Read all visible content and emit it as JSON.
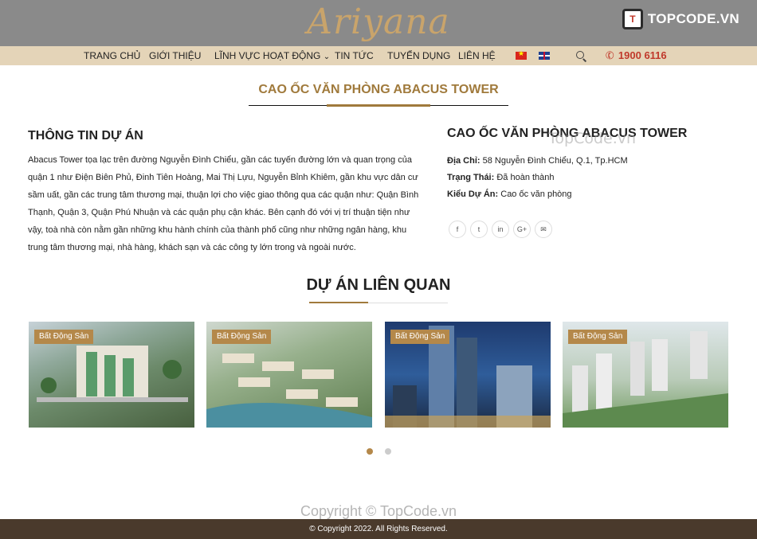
{
  "header": {
    "logo_text": "Ariyana",
    "brand": "TOPCODE.VN",
    "brand_icon": "topcode-logo-icon"
  },
  "nav": {
    "items": [
      "TRANG CHỦ",
      "GIỚI THIỆU",
      "LĨNH VỰC HOẠT ĐỘNG",
      "TIN TỨC",
      "TUYỂN DỤNG",
      "LIÊN HỆ"
    ],
    "dropdown_glyph": "⌄",
    "phone_icon": "phone-icon",
    "phone": "1900 6116",
    "phone_color": "#c0392b"
  },
  "page_title": "CAO ỐC VĂN PHÒNG ABACUS TOWER",
  "info": {
    "heading": "THÔNG TIN DỰ ÁN",
    "description": "Abacus Tower tọa lạc trên đường Nguyễn Đình Chiểu, gần các tuyến đường lớn và quan trọng của quận 1 như Điện Biên Phủ, Đinh Tiên Hoàng, Mai Thị Lựu, Nguyễn Bỉnh Khiêm, gần khu vực dân cư sầm uất, gần các trung tâm thương mại, thuận lợi cho việc giao thông qua các quận như: Quận Bình Thạnh, Quận 3, Quận Phú Nhuận và các quận phụ cận khác. Bên cạnh đó với vị trí thuận tiện như vậy, toà nhà còn nằm gần những khu hành chính của thành phố cũng như những ngân hàng, khu trung tâm thương mại, nhà hàng, khách sạn và các công ty lớn trong và ngoài nước."
  },
  "side": {
    "title": "CAO ỐC VĂN PHÒNG ABACUS TOWER",
    "watermark": "TopCode.vn",
    "address_label": "Địa Chỉ:",
    "address": "58 Nguyễn Đình Chiểu, Q.1, Tp.HCM",
    "status_label": "Trạng Thái:",
    "status": "Đã hoàn thành",
    "type_label": "Kiểu Dự Án:",
    "type": "Cao ốc văn phòng",
    "social": [
      {
        "icon": "facebook-icon",
        "glyph": "f"
      },
      {
        "icon": "twitter-icon",
        "glyph": "t"
      },
      {
        "icon": "linkedin-icon",
        "glyph": "in"
      },
      {
        "icon": "google-plus-icon",
        "glyph": "G+"
      },
      {
        "icon": "email-icon",
        "glyph": "✉"
      }
    ]
  },
  "related": {
    "heading": "DỰ ÁN LIÊN QUAN",
    "cards": [
      {
        "badge": "Bất Động Sản"
      },
      {
        "badge": "Bất Động Sản"
      },
      {
        "badge": "Bất Động Sản"
      },
      {
        "badge": "Bất Động Sản"
      }
    ],
    "active_dot_color": "#b4884a",
    "dot_color": "#cccccc"
  },
  "watermark_bottom": "Copyright © TopCode.vn",
  "footer": "© Copyright 2022. All Rights Reserved.",
  "colors": {
    "accent": "#a07a3c",
    "header_bg": "#8a8a8a",
    "nav_bg": "#e4d4b8",
    "footer_bg": "#4a3a2c"
  }
}
